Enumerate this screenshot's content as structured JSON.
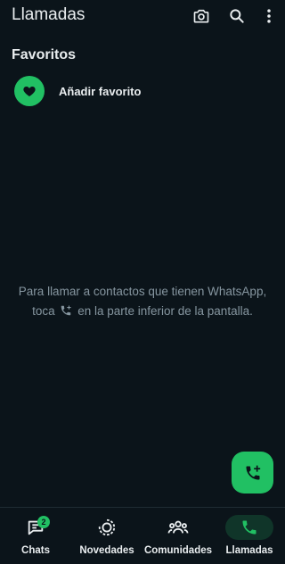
{
  "header": {
    "title": "Llamadas",
    "icons": [
      "camera-icon",
      "search-icon",
      "more-vert-icon"
    ]
  },
  "favorites": {
    "section_title": "Favoritos",
    "add_label": "Añadir favorito",
    "icon": "heart-icon"
  },
  "empty_state": {
    "text_before_icon": "Para llamar a contactos que tienen WhatsApp, toca",
    "icon": "add-call-icon",
    "text_after_icon": "en la parte inferior de la pantalla."
  },
  "fab": {
    "icon": "add-call-icon"
  },
  "bottom_nav": {
    "items": [
      {
        "label": "Chats",
        "icon": "chat-icon",
        "badge": "2",
        "active": false
      },
      {
        "label": "Novedades",
        "icon": "status-icon",
        "active": false
      },
      {
        "label": "Comunidades",
        "icon": "communities-icon",
        "active": false
      },
      {
        "label": "Llamadas",
        "icon": "phone-icon",
        "active": true
      }
    ]
  },
  "colors": {
    "background": "#0b141a",
    "accent": "#21c063",
    "text_primary": "#e9edef",
    "text_secondary": "#8696a0",
    "active_pill": "#103529"
  }
}
